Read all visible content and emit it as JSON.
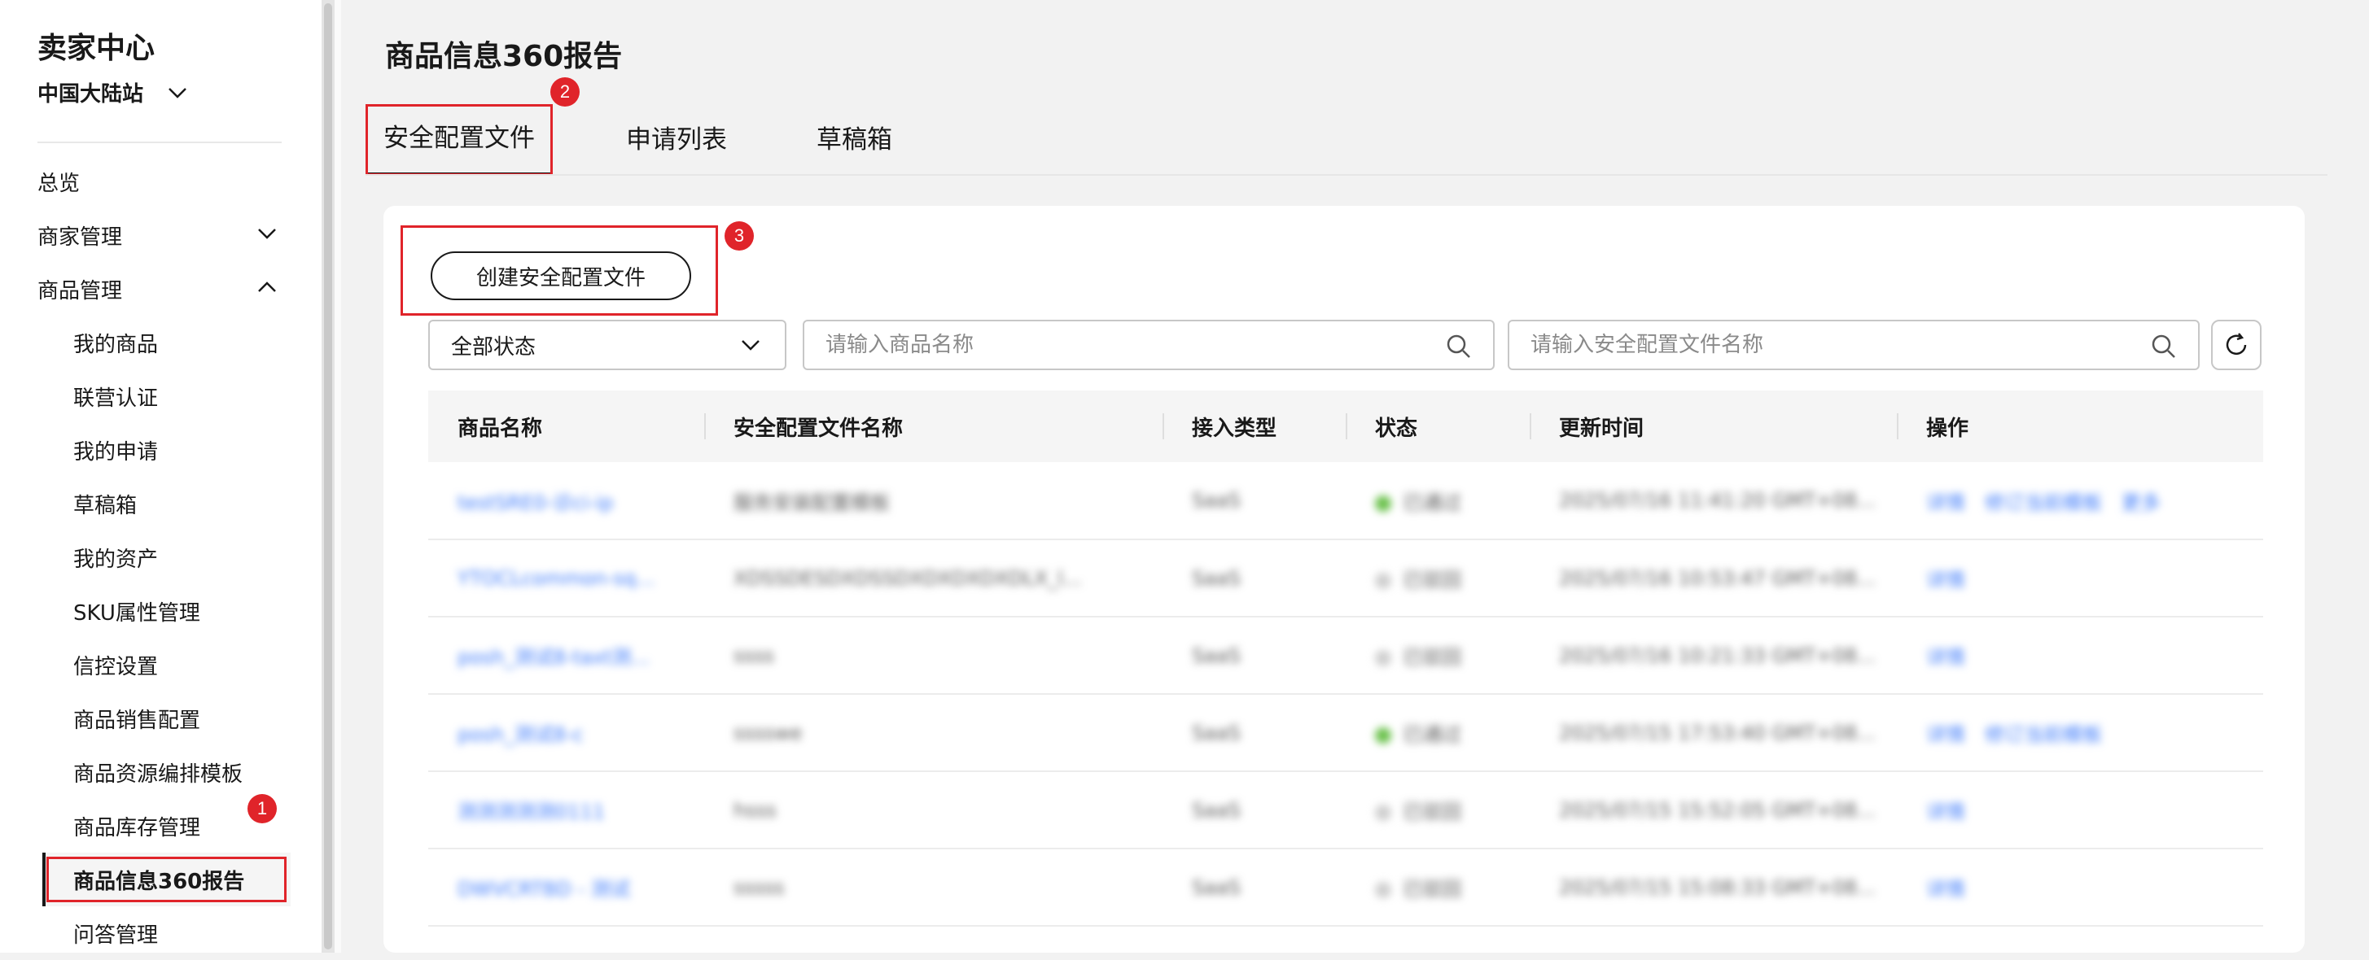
{
  "sidebar": {
    "brand": "卖家中心",
    "region": "中国大陆站",
    "items": [
      {
        "label": "总览",
        "level": 1
      },
      {
        "label": "商家管理",
        "level": 1,
        "expandable": true,
        "expanded": false
      },
      {
        "label": "商品管理",
        "level": 1,
        "expandable": true,
        "expanded": true
      },
      {
        "label": "我的商品",
        "level": 2
      },
      {
        "label": "联营认证",
        "level": 2
      },
      {
        "label": "我的申请",
        "level": 2
      },
      {
        "label": "草稿箱",
        "level": 2
      },
      {
        "label": "我的资产",
        "level": 2
      },
      {
        "label": "SKU属性管理",
        "level": 2
      },
      {
        "label": "信控设置",
        "level": 2
      },
      {
        "label": "商品销售配置",
        "level": 2
      },
      {
        "label": "商品资源编排模板",
        "level": 2
      },
      {
        "label": "商品库存管理",
        "level": 2
      },
      {
        "label": "商品信息360报告",
        "level": 2,
        "active": true
      },
      {
        "label": "问答管理",
        "level": 2
      }
    ]
  },
  "header": {
    "title": "商品信息360报告",
    "tabs": [
      {
        "label": "安全配置文件",
        "active": true
      },
      {
        "label": "申请列表"
      },
      {
        "label": "草稿箱"
      }
    ]
  },
  "markers": [
    "1",
    "2",
    "3"
  ],
  "toolbar": {
    "create_label": "创建安全配置文件",
    "status_select": "全部状态",
    "product_search_placeholder": "请输入商品名称",
    "profile_search_placeholder": "请输入安全配置文件名称"
  },
  "table": {
    "columns": [
      "商品名称",
      "安全配置文件名称",
      "接入类型",
      "状态",
      "更新时间",
      "操作"
    ],
    "rows": [
      {
        "product": "testSRE0-诊ci-ip",
        "profile": "服务安装配置模板",
        "type": "SaaS",
        "status": "已通过",
        "status_color": "#6ac14b",
        "time": "2025/07/16 11:41:20 GMT+08...",
        "ops": [
          "详情",
          "修订当前模板",
          "更多"
        ]
      },
      {
        "product": "YTOCLcommon-sq...",
        "profile": "XDSSDESDXDSSDXDXDXDXDLX_l...",
        "type": "SaaS",
        "status": "已驳回",
        "status_color": "#cfcfcf",
        "time": "2025/07/16 10:53:47 GMT+08...",
        "ops": [
          "详情"
        ]
      },
      {
        "product": "posh_测试8-taxt测...",
        "profile": "ssss",
        "type": "SaaS",
        "status": "已驳回",
        "status_color": "#cfcfcf",
        "time": "2025/07/16 10:21:33 GMT+08...",
        "ops": [
          "详情"
        ]
      },
      {
        "product": "posh_测试8-c",
        "profile": "sssswe",
        "type": "SaaS",
        "status": "已通过",
        "status_color": "#6ac14b",
        "time": "2025/07/15 17:53:40 GMT+08...",
        "ops": [
          "详情",
          "修订当前模板"
        ]
      },
      {
        "product": "测测测测测0111",
        "profile": "hsss",
        "type": "SaaS",
        "status": "已驳回",
        "status_color": "#cfcfcf",
        "time": "2025/07/15 15:52:05 GMT+08...",
        "ops": [
          "详情"
        ]
      },
      {
        "product": "DWVCRTBD - 测试",
        "profile": "sssss",
        "type": "SaaS",
        "status": "已驳回",
        "status_color": "#cfcfcf",
        "time": "2025/07/15 15:08:33 GMT+08...",
        "ops": [
          "详情"
        ]
      }
    ]
  },
  "colors": {
    "accent": "#e0242a",
    "link": "#3e7bfa",
    "success": "#6ac14b"
  }
}
